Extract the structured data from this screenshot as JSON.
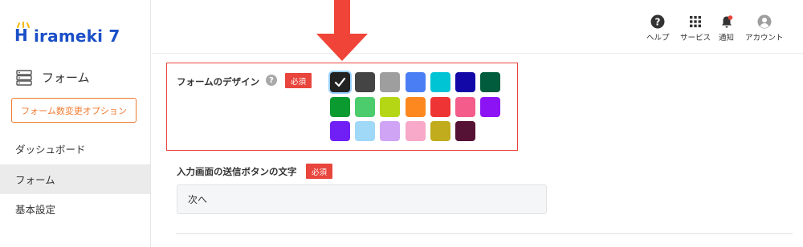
{
  "app": {
    "logo_text": "irameki 7",
    "logo_letter": "H"
  },
  "sidebar": {
    "section_title": "フォーム",
    "option_button_label": "フォーム数変更オプション",
    "items": [
      {
        "label": "ダッシュボード",
        "active": false
      },
      {
        "label": "フォーム",
        "active": true
      },
      {
        "label": "基本設定",
        "active": false
      }
    ]
  },
  "header": {
    "icons": [
      {
        "icon": "help-icon",
        "label": "ヘルプ"
      },
      {
        "icon": "grid-icon",
        "label": "サービス"
      },
      {
        "icon": "bell-icon",
        "label": "通知"
      },
      {
        "icon": "account-icon",
        "label": "アカウント"
      }
    ]
  },
  "form_design": {
    "label": "フォームのデザイン",
    "help_glyph": "?",
    "required_badge": "必須",
    "selected_index": 0,
    "colors": [
      "#222222",
      "#444444",
      "#9e9e9e",
      "#4a7ef5",
      "#00c4d4",
      "#1208a8",
      "#005c3c",
      "#0a9a30",
      "#4ccc6c",
      "#b4d614",
      "#fe8820",
      "#ee3434",
      "#f45c8c",
      "#8c14f4",
      "#7020f4",
      "#a0d8f8",
      "#d0a4f4",
      "#f8a8c8",
      "#c0ac1c",
      "#561234"
    ]
  },
  "submit_button_text": {
    "label": "入力画面の送信ボタンの文字",
    "required_badge": "必須",
    "value": "次へ"
  },
  "accent_colors": {
    "brand_blue": "#1a4fc7",
    "orange": "#f07a30",
    "required_red": "#e8453c",
    "arrow_red": "#f04438"
  }
}
